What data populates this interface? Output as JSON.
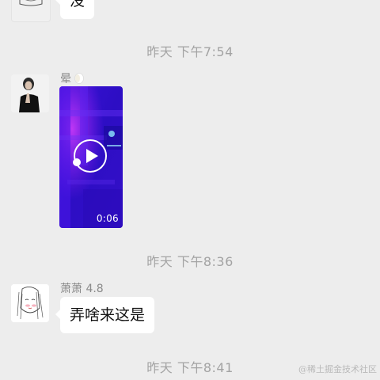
{
  "messages": {
    "top_partial": {
      "text": "没"
    },
    "ts1": "昨天 下午7:54",
    "msg1": {
      "sender": "晕",
      "video_duration": "0:06"
    },
    "ts2": "昨天 下午8:36",
    "msg2": {
      "sender": "萧萧 4.8",
      "text": "弄啥来这是"
    },
    "ts3": "昨天 下午8:41"
  },
  "watermark": "@稀土掘金技术社区",
  "icons": {
    "play": "play-icon",
    "moon": "moon-icon"
  },
  "colors": {
    "background": "#ededed",
    "bubble": "#ffffff",
    "timestamp": "#a3a3a3"
  }
}
